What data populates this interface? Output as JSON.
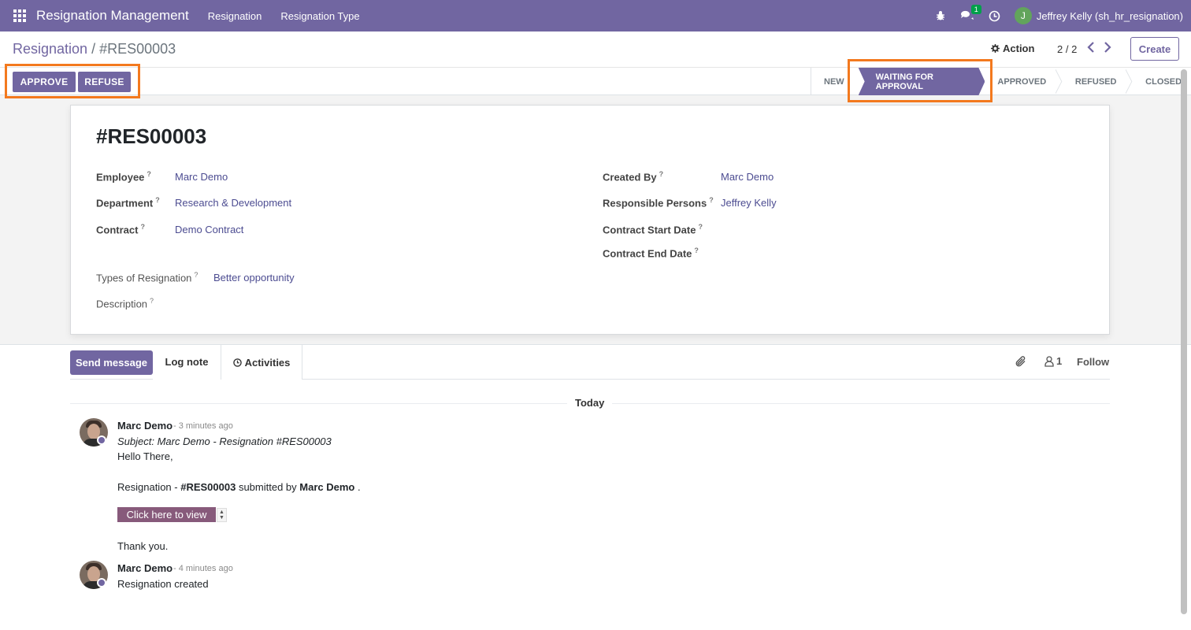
{
  "navbar": {
    "brand": "Resignation Management",
    "menu": [
      "Resignation",
      "Resignation Type"
    ],
    "messages_badge": "1",
    "user_initial": "J",
    "user_name": "Jeffrey Kelly (sh_hr_resignation)"
  },
  "control_panel": {
    "breadcrumb_parent": "Resignation",
    "breadcrumb_sep": "/",
    "breadcrumb_current": "#RES00003",
    "action_label": "Action",
    "pager": "2 / 2",
    "create_label": "Create"
  },
  "header_buttons": {
    "approve": "APPROVE",
    "refuse": "REFUSE"
  },
  "statusbar": {
    "stages": [
      "NEW",
      "WAITING FOR APPROVAL",
      "APPROVED",
      "REFUSED",
      "CLOSED"
    ],
    "active_stage": "WAITING FOR APPROVAL"
  },
  "form": {
    "name": "#RES00003",
    "left_fields": [
      {
        "label": "Employee",
        "value": "Marc Demo"
      },
      {
        "label": "Department",
        "value": "Research & Development"
      },
      {
        "label": "Contract",
        "value": "Demo Contract"
      }
    ],
    "right_fields": [
      {
        "label": "Created By",
        "value": "Marc Demo"
      },
      {
        "label": "Responsible Persons",
        "value": "Jeffrey Kelly"
      },
      {
        "label": "Contract Start Date",
        "value": ""
      },
      {
        "label": "Contract End Date",
        "value": ""
      }
    ],
    "bottom_fields": [
      {
        "label": "Types of Resignation",
        "value": "Better opportunity"
      },
      {
        "label": "Description",
        "value": ""
      }
    ],
    "help_mark": "?"
  },
  "chatter": {
    "send_message": "Send message",
    "log_note": "Log note",
    "activities": "Activities",
    "followers_count": "1",
    "follow": "Follow",
    "date_separator": "Today",
    "messages": [
      {
        "author": "Marc Demo",
        "time": "- 3 minutes ago",
        "subject": "Subject: Marc Demo - Resignation #RES00003",
        "greeting": "Hello There,",
        "line_prefix": "Resignation - ",
        "line_ref": "#RES00003",
        "line_mid": " submitted by ",
        "line_author": "Marc Demo",
        "line_end": " .",
        "button": "Click here to view",
        "closing": "Thank you."
      },
      {
        "author": "Marc Demo",
        "time": "- 4 minutes ago",
        "body": "Resignation created"
      }
    ]
  },
  "colors": {
    "brand": "#7166a1",
    "highlight": "#f3791e",
    "link": "#4c4c91",
    "view_button": "#875a7b"
  }
}
